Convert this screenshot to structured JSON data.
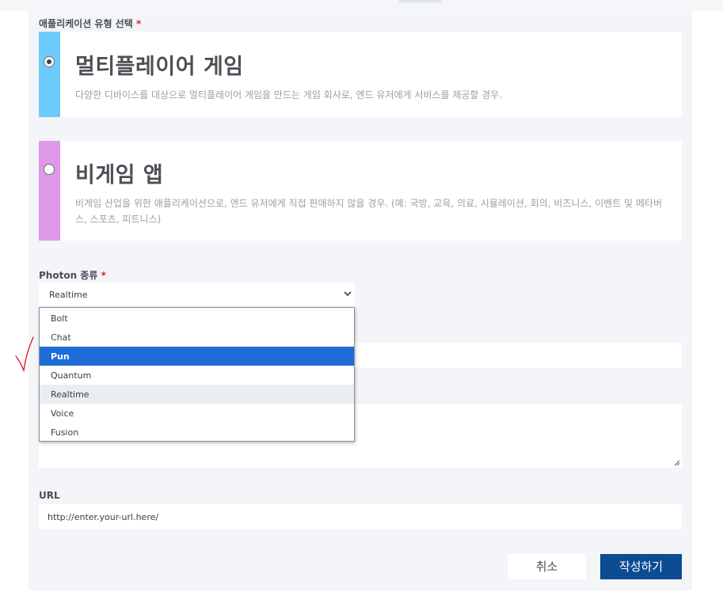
{
  "app_type": {
    "label": "애플리케이션 유형 선택",
    "required_mark": "*",
    "options": [
      {
        "title": "멀티플레이어 게임",
        "description": "다양한 디바이스를 대상으로 멀티플레이어 게임을 만드는 게임 회사로, 엔드 유저에게 서비스를 제공할 경우.",
        "selected": true,
        "accent_color": "#6ccbfb"
      },
      {
        "title": "비게임 앱",
        "description": "비게임 산업을 위한 애플리케이션으로, 엔드 유저에게 직접 판매하지 않을 경우. (예: 국방, 교육, 의료, 시뮬레이션, 회의, 비즈니스, 이벤트 및 메타버스, 스포츠, 피트니스)",
        "selected": false,
        "accent_color": "#dd99e8"
      }
    ]
  },
  "photon_type": {
    "label": "Photon 종류",
    "required_mark": "*",
    "selected_value": "Realtime",
    "dropdown_open": true,
    "options": [
      "Bolt",
      "Chat",
      "Pun",
      "Quantum",
      "Realtime",
      "Voice",
      "Fusion"
    ],
    "highlighted_option": "Pun",
    "hovered_option": "Realtime"
  },
  "url": {
    "label": "URL",
    "placeholder": "http://enter.your-url.here/"
  },
  "buttons": {
    "cancel": "취소",
    "submit": "작성하기"
  },
  "colors": {
    "submit_bg": "#0c4c92",
    "selected_option_bg": "#1f6dd6",
    "required_mark": "#e02424",
    "annotation_stroke": "#e0141e"
  }
}
